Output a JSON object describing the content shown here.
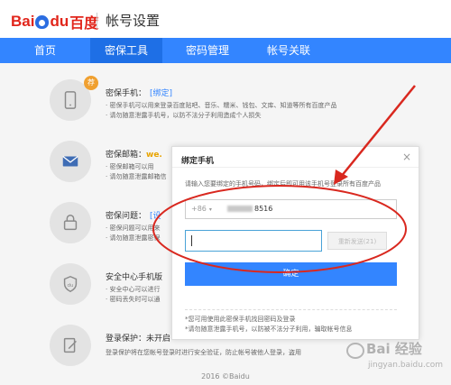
{
  "header": {
    "logo_latin": "Bai",
    "logo_latin2": "du",
    "logo_cn": "百度",
    "title": "帐号设置"
  },
  "nav": {
    "items": [
      {
        "label": "首页",
        "active": false
      },
      {
        "label": "密保工具",
        "active": true
      },
      {
        "label": "密码管理",
        "active": false
      },
      {
        "label": "帐号关联",
        "active": false
      }
    ]
  },
  "rows": [
    {
      "icon": "phone-icon",
      "badge": "荐",
      "title": "密保手机：",
      "link": "[绑定]",
      "desc": [
        "· 密保手机可以用来登录百度贴吧、音乐、糯米、钱包、文库、知道等所有百度产品",
        "· 请勿随意泄露手机号，以防不法分子利用造成个人损失"
      ]
    },
    {
      "icon": "mail-icon",
      "title": "密保邮箱：",
      "extra": "we.",
      "desc": [
        "· 密保邮箱可以用",
        "· 请勿随意泄露邮箱信"
      ]
    },
    {
      "icon": "lock-icon",
      "title": "密保问题：",
      "extra": "[设",
      "desc": [
        "· 密保问题可以用来",
        "· 请勿随意泄露密保"
      ]
    },
    {
      "icon": "du-shield-icon",
      "title": "安全中心手机版",
      "desc": [
        "· 安全中心可以进行",
        "· 密码丢失时可以通"
      ]
    },
    {
      "icon": "edit-icon",
      "title": "登录保护：未开启",
      "desc": [
        "登录保护将在您帐号登录时进行安全验证，防止帐号被他人登录，盗用"
      ]
    }
  ],
  "footer": "2016 ©Baidu",
  "dialog": {
    "title": "绑定手机",
    "close": "×",
    "intro": "请输入您要绑定的手机号码，绑定后即可用该手机号登录所有百度产品",
    "country_code": "+86",
    "phone_suffix": "8516",
    "resend": "重新发送(21)",
    "confirm": "确定",
    "notes": [
      "*您可用使用此密保手机找回密码及登录",
      "*请勿随意泄露手机号，以防被不法分子利用，骗取帐号信息"
    ]
  },
  "watermark": {
    "text": "Bai 经验",
    "sub": "jingyan.baidu.com"
  },
  "colors": {
    "nav_bg": "#3385ff",
    "nav_active": "#1e6fe6",
    "annotation_red": "#d9281f",
    "brand_red": "#e1251b",
    "brand_blue": "#2b6de1"
  }
}
